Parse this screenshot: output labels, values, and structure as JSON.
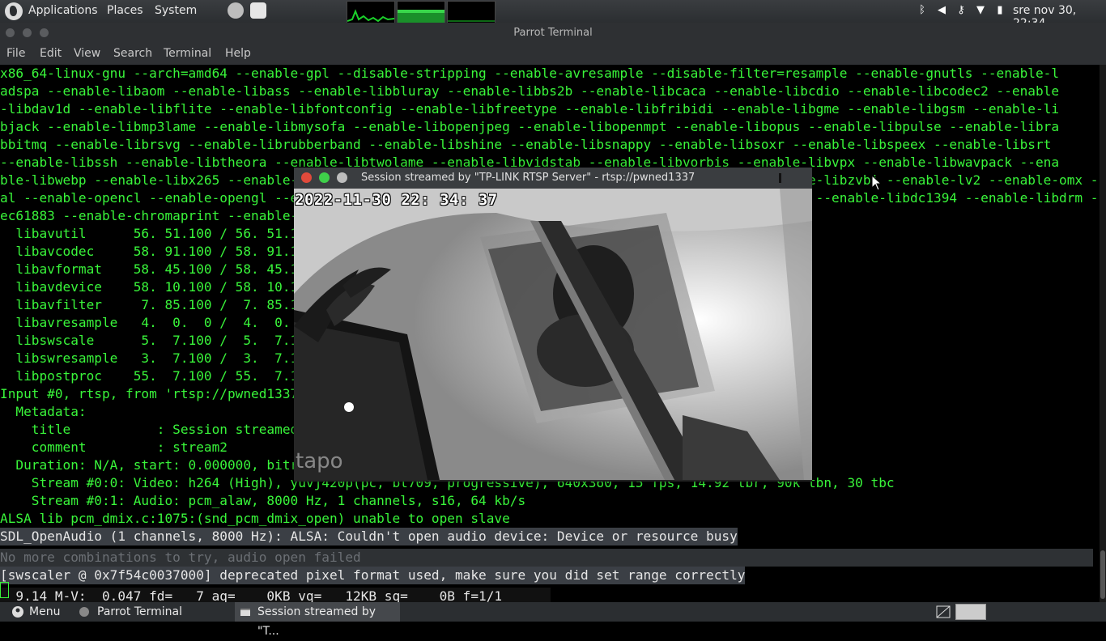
{
  "topbar": {
    "menus": [
      "Applications",
      "Places",
      "System"
    ],
    "clock": "sre nov 30, 22:34"
  },
  "terminal_window": {
    "title": "Parrot Terminal",
    "menu": [
      "File",
      "Edit",
      "View",
      "Search",
      "Terminal",
      "Help"
    ],
    "lines": [
      {
        "text": "x86_64-linux-gnu --arch=amd64 --enable-gpl --disable-stripping --enable-avresample --disable-filter=resample --enable-gnutls --enable-l",
        "style": "green"
      },
      {
        "text": "adspa --enable-libaom --enable-libass --enable-libbluray --enable-libbs2b --enable-libcaca --enable-libcdio --enable-libcodec2 --enable",
        "style": "green"
      },
      {
        "text": "-libdav1d --enable-libflite --enable-libfontconfig --enable-libfreetype --enable-libfribidi --enable-libgme --enable-libgsm --enable-li",
        "style": "green"
      },
      {
        "text": "bjack --enable-libmp3lame --enable-libmysofa --enable-libopenjpeg --enable-libopenmpt --enable-libopus --enable-libpulse --enable-libra",
        "style": "green"
      },
      {
        "text": "bbitmq --enable-librsvg --enable-librubberband --enable-libshine --enable-libsnappy --enable-libsoxr --enable-libspeex --enable-libsrt ",
        "style": "green"
      },
      {
        "text": "--enable-libssh --enable-libtheora --enable-libtwolame --enable-libvidstab --enable-libvorbis --enable-libvpx --enable-libwavpack --ena",
        "style": "green"
      },
      {
        "text": "ble-libwebp --enable-libx265 --enable-libxml2 --enable-libxvid --enable-libzimg --enable-libzmq --enable-libzvbi --enable-lv2 --enable-omx --enable-open",
        "style": "green"
      },
      {
        "text": "al --enable-opencl --enable-opengl --enable-sdl2 --enable-pocketsphinx --enable-librsvg --enable-libmfx --enable-libdc1394 --enable-libdrm --enable-libi",
        "style": "green"
      },
      {
        "text": "ec61883 --enable-chromaprint --enable-frei0r --enable-libx264 --enable-shared",
        "style": "green"
      },
      {
        "text": "  libavutil      56. 51.100 / 56. 51.100",
        "style": "green"
      },
      {
        "text": "  libavcodec     58. 91.100 / 58. 91.100",
        "style": "green"
      },
      {
        "text": "  libavformat    58. 45.100 / 58. 45.100",
        "style": "green"
      },
      {
        "text": "  libavdevice    58. 10.100 / 58. 10.100",
        "style": "green"
      },
      {
        "text": "  libavfilter     7. 85.100 /  7. 85.100",
        "style": "green"
      },
      {
        "text": "  libavresample   4.  0.  0 /  4.  0.  0",
        "style": "green"
      },
      {
        "text": "  libswscale      5.  7.100 /  5.  7.100",
        "style": "green"
      },
      {
        "text": "  libswresample   3.  7.100 /  3.  7.100",
        "style": "green"
      },
      {
        "text": "  libpostproc    55.  7.100 / 55.  7.100",
        "style": "green"
      },
      {
        "text": "Input #0, rtsp, from 'rtsp://pwned1337",
        "style": "green"
      },
      {
        "text": "  Metadata:",
        "style": "green"
      },
      {
        "text": "    title           : Session streamed by \"TP-LINK RTSP Server\"",
        "style": "green"
      },
      {
        "text": "    comment         : stream2",
        "style": "green"
      },
      {
        "text": "  Duration: N/A, start: 0.000000, bitrate: N/A",
        "style": "green"
      },
      {
        "text": "    Stream #0:0: Video: h264 (High), yuvj420p(pc, bt709, progressive), 640x360, 15 fps, 14.92 tbr, 90k tbn, 30 tbc",
        "style": "green"
      },
      {
        "text": "    Stream #0:1: Audio: pcm_alaw, 8000 Hz, 1 channels, s16, 64 kb/s",
        "style": "green"
      },
      {
        "text": "ALSA lib pcm_dmix.c:1075:(snd_pcm_dmix_open) unable to open slave",
        "style": "green"
      },
      {
        "text": "SDL_OpenAudio (1 channels, 8000 Hz): ALSA: Couldn't open audio device: Device or resource busy",
        "style": "hl"
      },
      {
        "text": "No more combinations to try, audio open failed",
        "style": "gray"
      },
      {
        "text": "[swscaler @ 0x7f54c0037000] deprecated pixel format used, make sure you did set range correctly",
        "style": "hl"
      },
      {
        "text": "  9.14 M-V:  0.047 fd=   7 aq=    0KB vq=   12KB sq=    0B f=1/1",
        "style": "status"
      }
    ]
  },
  "video_window": {
    "title": "Session streamed by \"TP-LINK RTSP Server\" - rtsp://pwned1337",
    "timestamp": "2022-11-30  22: 34: 37",
    "watermark": "tapo"
  },
  "taskbar": {
    "menu_label": "Menu",
    "items": [
      "Parrot Terminal",
      "Session streamed by \"T..."
    ]
  },
  "colors": {
    "terminal_text": "#39f53a",
    "terminal_bg": "#000000",
    "panel_bg": "#2b2e31"
  }
}
